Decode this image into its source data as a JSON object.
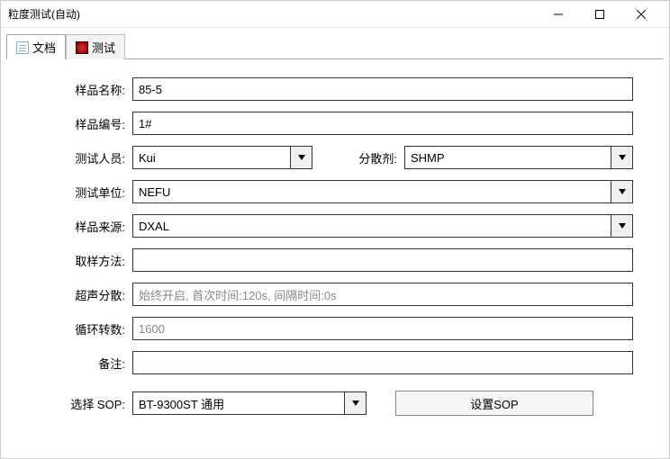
{
  "window": {
    "title": "粒度测试(自动)"
  },
  "tabs": {
    "doc": "文档",
    "test": "测试"
  },
  "labels": {
    "sample_name": "样品名称:",
    "sample_no": "样品编号:",
    "tester": "测试人员:",
    "dispersant": "分散剂:",
    "test_unit": "测试单位:",
    "sample_source": "样品来源:",
    "sampling_method": "取样方法:",
    "ultrasonic": "超声分散:",
    "cycle_speed": "循环转数:",
    "remark": "备注:",
    "select_sop": "选择 SOP:"
  },
  "values": {
    "sample_name": "85-5",
    "sample_no": "1#",
    "tester": "Kui",
    "dispersant": "SHMP",
    "test_unit": "NEFU",
    "sample_source": "DXAL",
    "sampling_method": "",
    "ultrasonic": "始终开启, 首次时间:120s, 间隔时间:0s",
    "cycle_speed": "1600",
    "remark": "",
    "sop": "BT-9300ST 通用"
  },
  "buttons": {
    "set_sop": "设置SOP"
  }
}
